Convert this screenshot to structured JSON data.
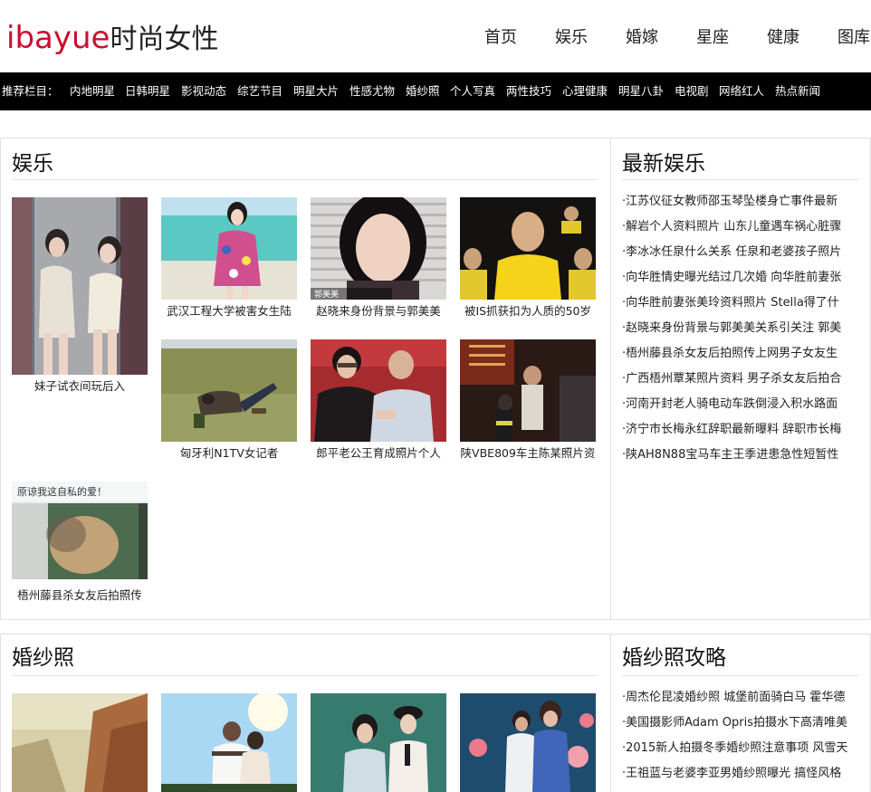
{
  "header": {
    "logo_brand": "ibayue",
    "logo_tag": "时尚女性",
    "nav": [
      "首页",
      "娱乐",
      "婚嫁",
      "星座",
      "健康",
      "图库"
    ]
  },
  "recbar": {
    "label": "推荐栏目：",
    "items": [
      "内地明星",
      "日韩明星",
      "影视动态",
      "综艺节目",
      "明星大片",
      "性感尤物",
      "婚纱照",
      "个人写真",
      "两性技巧",
      "心理健康",
      "明星八卦",
      "电视剧",
      "网络红人",
      "热点新闻"
    ]
  },
  "ent": {
    "title": "娱乐",
    "side_title": "最新娱乐",
    "thumbs": [
      {
        "caption": "妹子试衣间玩后入",
        "img": "girls-fitting-room-photo"
      },
      {
        "caption": "武汉工程大学被害女生陆",
        "img": "girl-floral-dress-beach-photo"
      },
      {
        "caption": "赵晓来身份背景与郭美美",
        "img": "woman-portrait-photo",
        "overlay": "郭美美"
      },
      {
        "caption": "被IS抓获扣为人质的50岁",
        "img": "hostage-yellow-suit-photo"
      },
      {
        "caption": "匈牙利N1TV女记者",
        "img": "field-trip-photo"
      },
      {
        "caption": "郎平老公王育成照片个人",
        "img": "couple-audience-photo"
      },
      {
        "caption": "陕VBE809车主陈某照片资",
        "img": "night-street-photo"
      },
      {
        "caption": "梧州藤县杀女友后拍照传",
        "img": "selfie-photo",
        "overlay": "原谅我这自私的爱！"
      }
    ],
    "news": [
      "·江苏仪征女教师邵玉琴坠楼身亡事件最新",
      "·解岩个人资料照片 山东儿童遇车祸心脏骤",
      "·李冰冰任泉什么关系 任泉和老婆孩子照片",
      "·向华胜情史曝光结过几次婚 向华胜前妻张",
      "·向华胜前妻张美玲资料照片 Stella得了什",
      "·赵晓来身份背景与郭美美关系引关注 郭美",
      "·梧州藤县杀女友后拍照传上网男子女友生",
      "·广西梧州覃某照片资料 男子杀女友后拍合",
      "·河南开封老人骑电动车跌倒浸入积水路面",
      "·济宁市长梅永红辞职最新曝料 辞职市长梅",
      "·陕AH8N88宝马车主王季进患急性短暂性"
    ]
  },
  "wed": {
    "title": "婚纱照",
    "side_title": "婚纱照攻略",
    "thumbs": [
      {
        "img": "autumn-forest-wedding-photo"
      },
      {
        "img": "sunny-couple-wedding-photo"
      },
      {
        "img": "couple-hats-wedding-photo"
      },
      {
        "img": "underwater-wedding-photo"
      }
    ],
    "news": [
      "·周杰伦昆凌婚纱照 城堡前面骑白马 霍华德",
      "·美国摄影师Adam Opris拍摄水下高清唯美",
      "·2015新人拍摄冬季婚纱照注意事项 风雪天",
      "·王祖蓝与老婆李亚男婚纱照曝光 搞怪风格"
    ]
  },
  "colors": {
    "brand": "#c8102e",
    "recbar_bg": "#000000",
    "border": "#e2e2e2"
  }
}
